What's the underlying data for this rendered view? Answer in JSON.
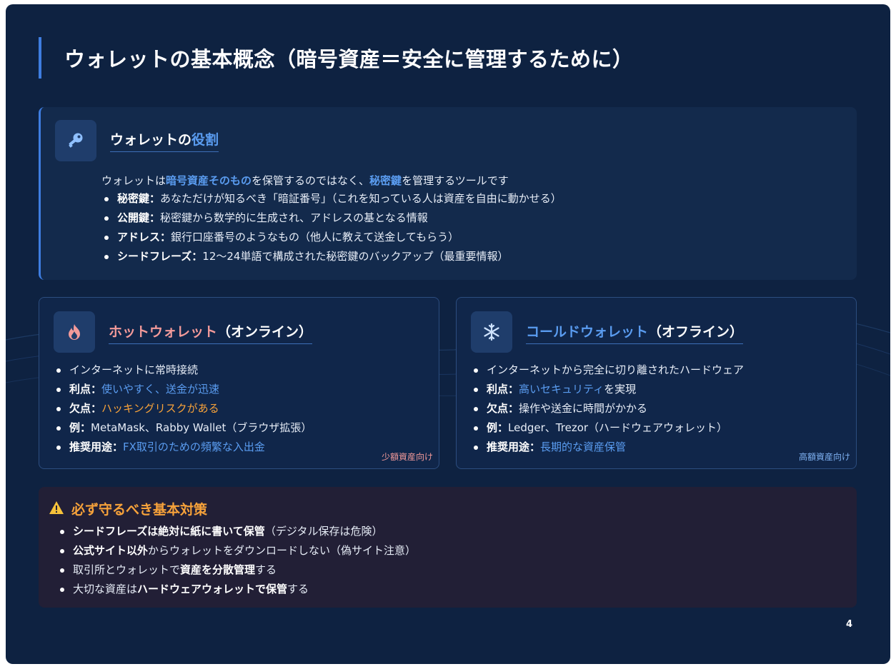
{
  "title": "ウォレットの基本概念（暗号資産＝安全に管理するために）",
  "role": {
    "icon": "key-icon",
    "title_prefix": "ウォレットの",
    "title_accent": "役割",
    "lead_1": "ウォレットは",
    "lead_hl1": "暗号資産そのもの",
    "lead_2": "を保管するのではなく、",
    "lead_hl2": "秘密鍵",
    "lead_3": "を管理するツールです",
    "items": [
      {
        "key": "秘密鍵",
        "sep": "：",
        "text": "あなただけが知るべき「暗証番号」（これを知っている人は資産を自由に動かせる）"
      },
      {
        "key": "公開鍵",
        "sep": "：",
        "text": "秘密鍵から数学的に生成され、アドレスの基となる情報"
      },
      {
        "key": "アドレス",
        "sep": "：",
        "text": "銀行口座番号のようなもの（他人に教えて送金してもらう）"
      },
      {
        "key": "シードフレーズ",
        "sep": "：",
        "text": "12〜24単語で構成された秘密鍵のバックアップ（最重要情報）"
      }
    ]
  },
  "hot": {
    "icon": "flame-icon",
    "title_accent": "ホットウォレット",
    "title_rest": "（オンライン）",
    "line1": "インターネットに常時接続",
    "merit_key": "利点",
    "merit_val": "使いやすく、送金が迅速",
    "demerit_key": "欠点",
    "demerit_val": "ハッキングリスクがある",
    "example_key": "例",
    "example_val": "MetaMask、Rabby Wallet（ブラウザ拡張）",
    "use_key": "推奨用途",
    "use_val": "FX取引のための頻繁な入出金",
    "tag": "少額資産向け"
  },
  "cold": {
    "icon": "snowflake-icon",
    "title_accent": "コールドウォレット",
    "title_rest": "（オフライン）",
    "line1": "インターネットから完全に切り離されたハードウェア",
    "merit_key": "利点",
    "merit_hl": "高いセキュリティ",
    "merit_rest": "を実現",
    "demerit_key": "欠点",
    "demerit_val": "操作や送金に時間がかかる",
    "example_key": "例",
    "example_val": "Ledger、Trezor（ハードウェアウォレット）",
    "use_key": "推奨用途",
    "use_val": "長期的な資産保管",
    "tag": "高額資産向け"
  },
  "warning": {
    "icon": "warning-icon",
    "title": "必ず守るべき基本対策",
    "item1_bold": "シードフレーズは絶対に紙に書いて保管",
    "item1_rest": "（デジタル保存は危険）",
    "item2_bold": "公式サイト以外",
    "item2_rest": "からウォレットをダウンロードしない（偽サイト注意）",
    "item3_pre": "取引所とウォレットで",
    "item3_bold": "資産を分散管理",
    "item3_post": "する",
    "item4_pre": "大切な資産は",
    "item4_bold": "ハードウェアウォレットで保管",
    "item4_post": "する"
  },
  "page_number": "4",
  "colors": {
    "background": "#0e2241",
    "accent_blue": "#5a9cf0",
    "accent_red": "#f39a9a",
    "accent_orange": "#f7a23a"
  }
}
